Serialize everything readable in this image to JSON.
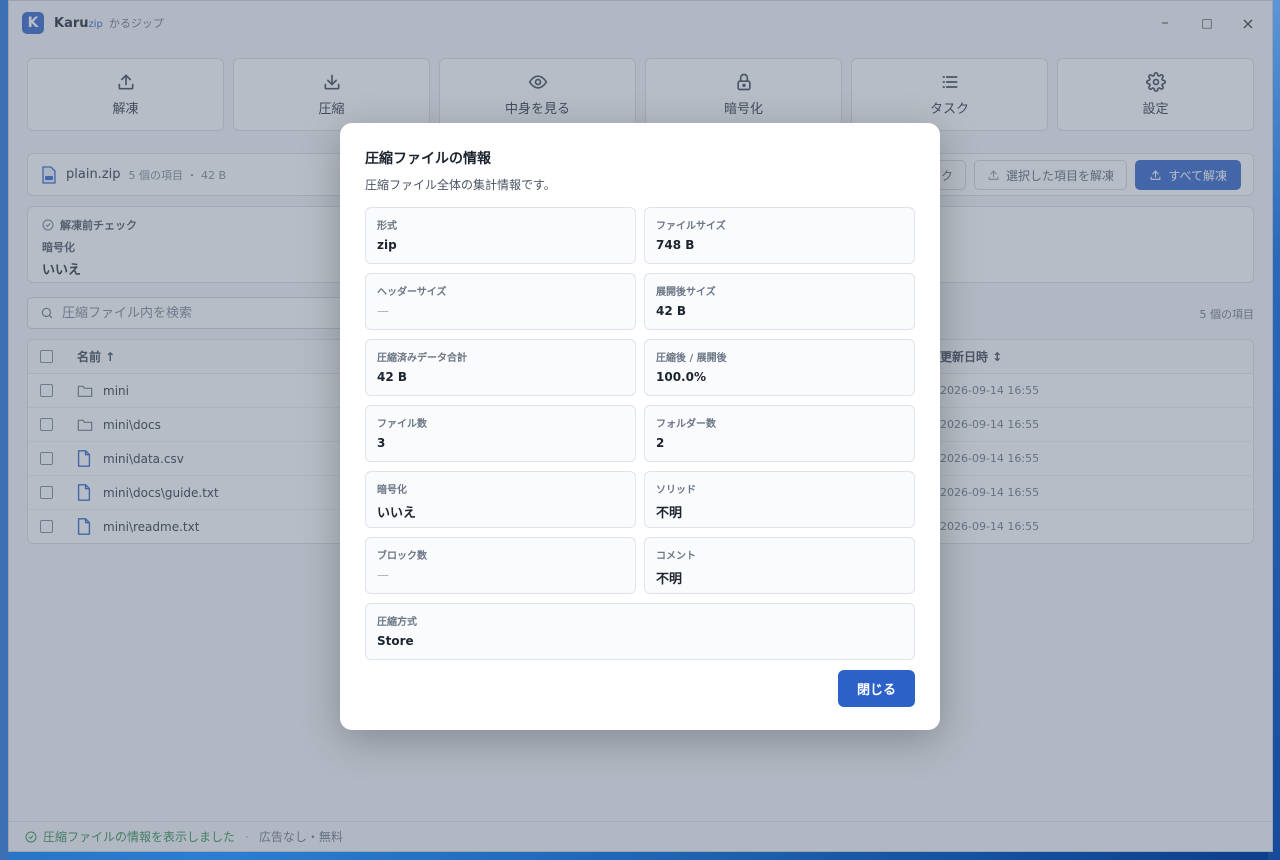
{
  "app": {
    "logo_letter": "K",
    "name": "Karu",
    "name_suffix": "zip",
    "subtitle": "かるジップ"
  },
  "window_controls": {
    "minimize": "–",
    "maximize": "□",
    "close": "×"
  },
  "toolbar": [
    {
      "label": "解凍",
      "icon": "upload-icon"
    },
    {
      "label": "圧縮",
      "icon": "download-icon"
    },
    {
      "label": "中身を見る",
      "icon": "eye-icon"
    },
    {
      "label": "暗号化",
      "icon": "lock-icon"
    },
    {
      "label": "タスク",
      "icon": "list-icon"
    },
    {
      "label": "設定",
      "icon": "gear-icon"
    }
  ],
  "archive": {
    "filename": "plain.zip",
    "meta": "5 個の項目 ・ 42 B"
  },
  "actions": {
    "partial_label": "ク",
    "extract_selected": "選択した項目を解凍",
    "extract_all": "すべて解凍"
  },
  "precheck": {
    "title": "解凍前チェック",
    "label": "暗号化",
    "value": "いいえ"
  },
  "search": {
    "placeholder": "圧縮ファイル内を検索"
  },
  "item_count": "5 個の項目",
  "table": {
    "col_name": "名前 ↑",
    "col_date": "更新日時 ↕",
    "rows": [
      {
        "type": "folder",
        "name": "mini",
        "date": "2026-09-14 16:55"
      },
      {
        "type": "folder",
        "name": "mini\\docs",
        "date": "2026-09-14 16:55"
      },
      {
        "type": "file",
        "name": "mini\\data.csv",
        "date": "2026-09-14 16:55"
      },
      {
        "type": "file",
        "name": "mini\\docs\\guide.txt",
        "date": "2026-09-14 16:55"
      },
      {
        "type": "file",
        "name": "mini\\readme.txt",
        "date": "2026-09-14 16:55"
      }
    ]
  },
  "status": {
    "message": "圧縮ファイルの情報を表示しました",
    "sep": "·",
    "ad": "広告なし・無料"
  },
  "modal": {
    "title": "圧縮ファイルの情報",
    "subtitle": "圧縮ファイル全体の集計情報です。",
    "fields": [
      {
        "label": "形式",
        "value": "zip"
      },
      {
        "label": "ファイルサイズ",
        "value": "748 B"
      },
      {
        "label": "ヘッダーサイズ",
        "value": "—"
      },
      {
        "label": "展開後サイズ",
        "value": "42 B"
      },
      {
        "label": "圧縮済みデータ合計",
        "value": "42 B"
      },
      {
        "label": "圧縮後 / 展開後",
        "value": "100.0%"
      },
      {
        "label": "ファイル数",
        "value": "3"
      },
      {
        "label": "フォルダー数",
        "value": "2"
      },
      {
        "label": "暗号化",
        "value": "いいえ"
      },
      {
        "label": "ソリッド",
        "value": "不明"
      },
      {
        "label": "ブロック数",
        "value": "—"
      },
      {
        "label": "コメント",
        "value": "不明"
      },
      {
        "label": "圧縮方式",
        "value": "Store"
      }
    ],
    "close_label": "閉じる"
  },
  "colors": {
    "accent": "#2c62c8",
    "success": "#2f8a4c"
  }
}
